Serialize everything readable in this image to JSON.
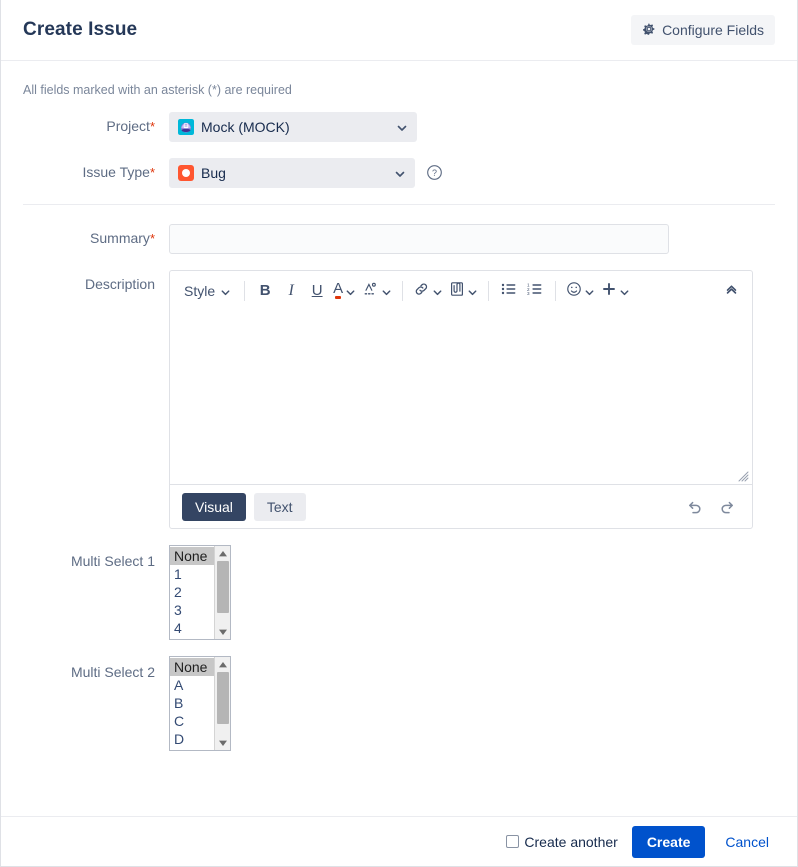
{
  "dialog": {
    "title": "Create Issue",
    "required_note": "All fields marked with an asterisk (*) are required"
  },
  "header": {
    "configure_label": "Configure Fields",
    "gear_icon": "gear-icon"
  },
  "fields": {
    "project": {
      "label": "Project",
      "required_marker": "*",
      "value": "Mock (MOCK)",
      "icon": "project-avatar-icon"
    },
    "issue_type": {
      "label": "Issue Type",
      "required_marker": "*",
      "value": "Bug",
      "icon": "bug-issue-type-icon",
      "help_icon": "help-circle-icon"
    },
    "summary": {
      "label": "Summary",
      "required_marker": "*",
      "value": "",
      "placeholder": ""
    },
    "description": {
      "label": "Description",
      "value": ""
    },
    "multi_select_1": {
      "label": "Multi Select 1",
      "options": [
        "None",
        "1",
        "2",
        "3",
        "4"
      ],
      "selected": "None"
    },
    "multi_select_2": {
      "label": "Multi Select 2",
      "options": [
        "None",
        "A",
        "B",
        "C",
        "D"
      ],
      "selected": "None"
    }
  },
  "editor": {
    "toolbar": {
      "style_label": "Style",
      "bold_label": "B",
      "italic_label": "I",
      "underline_label": "U",
      "text_color_label": "A",
      "more_formatting_icon": "clear-formatting-icon",
      "link_icon": "link-icon",
      "attach_icon": "attachment-icon",
      "bullet_list_icon": "bullet-list-icon",
      "numbered_list_icon": "numbered-list-icon",
      "emoji_icon": "emoji-icon",
      "insert_more_icon": "plus-icon",
      "collapse_icon": "chevron-double-up-icon"
    },
    "modes": [
      {
        "label": "Visual",
        "active": true
      },
      {
        "label": "Text",
        "active": false
      }
    ],
    "undo_icon": "undo-icon",
    "redo_icon": "redo-icon",
    "resize_handle": "resize-grip-icon"
  },
  "footer": {
    "create_another_label": "Create another",
    "create_another_checked": false,
    "create_label": "Create",
    "cancel_label": "Cancel"
  },
  "colors": {
    "primary": "#0052cc",
    "required": "#de350b",
    "bug": "#ff5630",
    "text": "#172b4d",
    "label": "#5e6c84",
    "active_tab": "#344563"
  }
}
